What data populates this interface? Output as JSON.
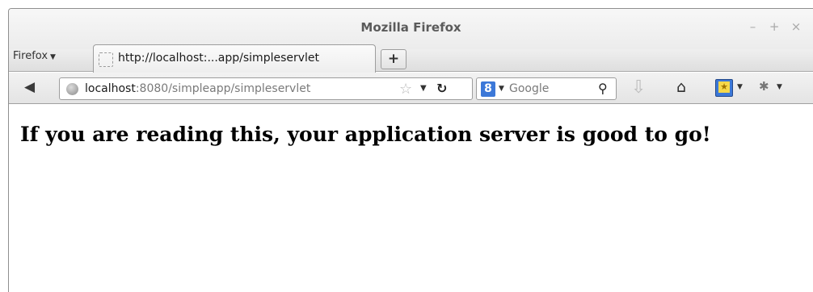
{
  "window": {
    "title": "Mozilla Firefox",
    "controls": [
      "–",
      "+",
      "×"
    ]
  },
  "menu": {
    "firefox_label": "Firefox"
  },
  "tab": {
    "label": "http://localhost:...app/simpleservlet",
    "new_tab_label": "+"
  },
  "url": {
    "host": "localhost",
    "rest": ":8080/simpleapp/simpleservlet"
  },
  "search": {
    "engine_letter": "8",
    "placeholder": "Google"
  },
  "page": {
    "heading": "If you are reading this, your application server is good to go!"
  },
  "icons": {
    "back": "back-arrow-icon",
    "globe": "globe-icon",
    "star": "bookmark-star-icon",
    "reload": "reload-icon",
    "search": "magnifier-icon",
    "download": "download-icon",
    "home": "home-icon",
    "bookmarks": "bookmarks-menu-icon",
    "addon": "addon-icon"
  }
}
